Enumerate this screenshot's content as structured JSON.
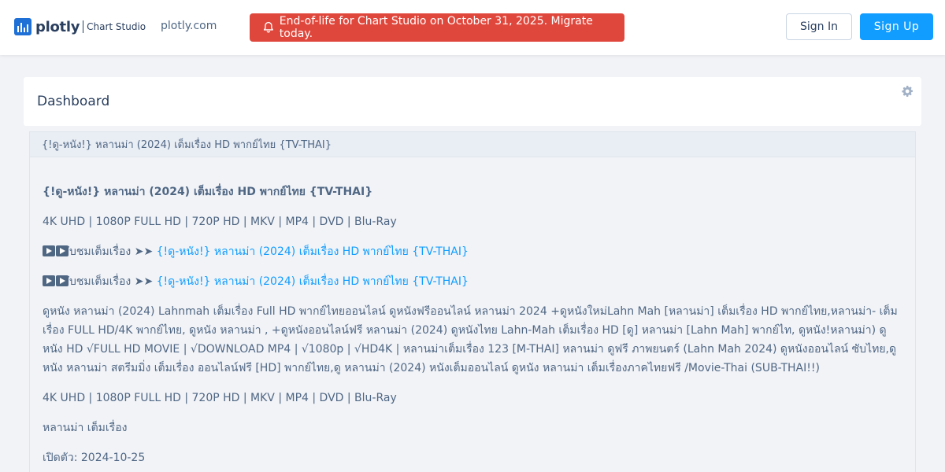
{
  "header": {
    "logo_word": "plotly",
    "logo_sub": "Chart Studio",
    "nav_link": "plotly.com",
    "banner_text": "End-of-life for Chart Studio on October 31, 2025. Migrate today.",
    "sign_in": "Sign In",
    "sign_up": "Sign Up"
  },
  "dashboard": {
    "title": "Dashboard"
  },
  "document": {
    "header_title": "{!ดู-หนัง!} หลานม่า (2024) เต็มเรื่อง HD พากย์ไทย {TV-THAI}",
    "heading": "{!ดู-หนัง!} หลานม่า (2024) เต็มเรื่อง HD พากย์ไทย {TV-THAI}",
    "formats_1": "4K UHD | 1080P FULL HD | 720P HD | MKV | MP4 | DVD | Blu-Ray",
    "watch_prefix": "ับชมเต็มเรื่อง ➤➤ ",
    "watch_link": "{!ดู-หนัง!} หลานม่า (2024) เต็มเรื่อง HD พากย์ไทย {TV-THAI}",
    "watch_prefix_2": "ับชมเต็มเรื่อง ➤➤ ",
    "watch_link_2": "{!ดู-หนัง!} หลานม่า (2024) เต็มเรื่อง HD พากย์ไทย {TV-THAI}",
    "description": "ดูหนัง หลานม่า (2024) Lahnmah เต็มเรื่อง Full HD พากย์ไทยออนไลน์ ดูหนังฟรีออนไลน์ หลานม่า 2024 +ดูหนังใหม่Lahn Mah [หลานม่า] เต็มเรื่อง HD พากย์ไทย,หลานม่า- เต็มเรื่อง FULL HD/4K พากย์ไทย, ดูหนัง หลานม่า , +ดูหนังออนไลน์ฟรี หลานม่า (2024) ดูหนังไทย Lahn-Mah เต็มเรื่อง HD [ดู] หลานม่า [Lahn Mah] พากย์ไท, ดูหนัง!หลานม่า) ดูหนัง HD √FULL HD MOVIE | √DOWNLOAD MP4 | √1080p | √HD4K | หลานม่าเต็มเรื่อง 123 [M-THAI] หลานม่า ดูฟรี ภาพยนตร์ (Lahn Mah 2024) ดูหนังออนไลน์ ซับไทย,ดูหนัง หลานม่า สตรีมมิ่ง เต็มเรื่อง ออนไลน์ฟรี [HD] พากย์ไทย,ดู หลานม่า (2024) หนังเต็มออนไลน์ ดูหนัง หลานม่า เต็มเรื่องภาคไทยฟรี /Movie-Thai (SUB-THAI!!)",
    "formats_2": "4K UHD | 1080P FULL HD | 720P HD | MKV | MP4 | DVD | Blu-Ray",
    "short_title": "หลานม่า เต็มเรื่อง",
    "release": "เปิดตัว: 2024-10-25"
  },
  "colors": {
    "brand_blue": "#119dff",
    "banner_red": "#e0473c",
    "text": "#2a3f5f"
  },
  "icons": [
    "plotly-logo-icon",
    "bell-icon",
    "gear-icon",
    "play-icon"
  ]
}
